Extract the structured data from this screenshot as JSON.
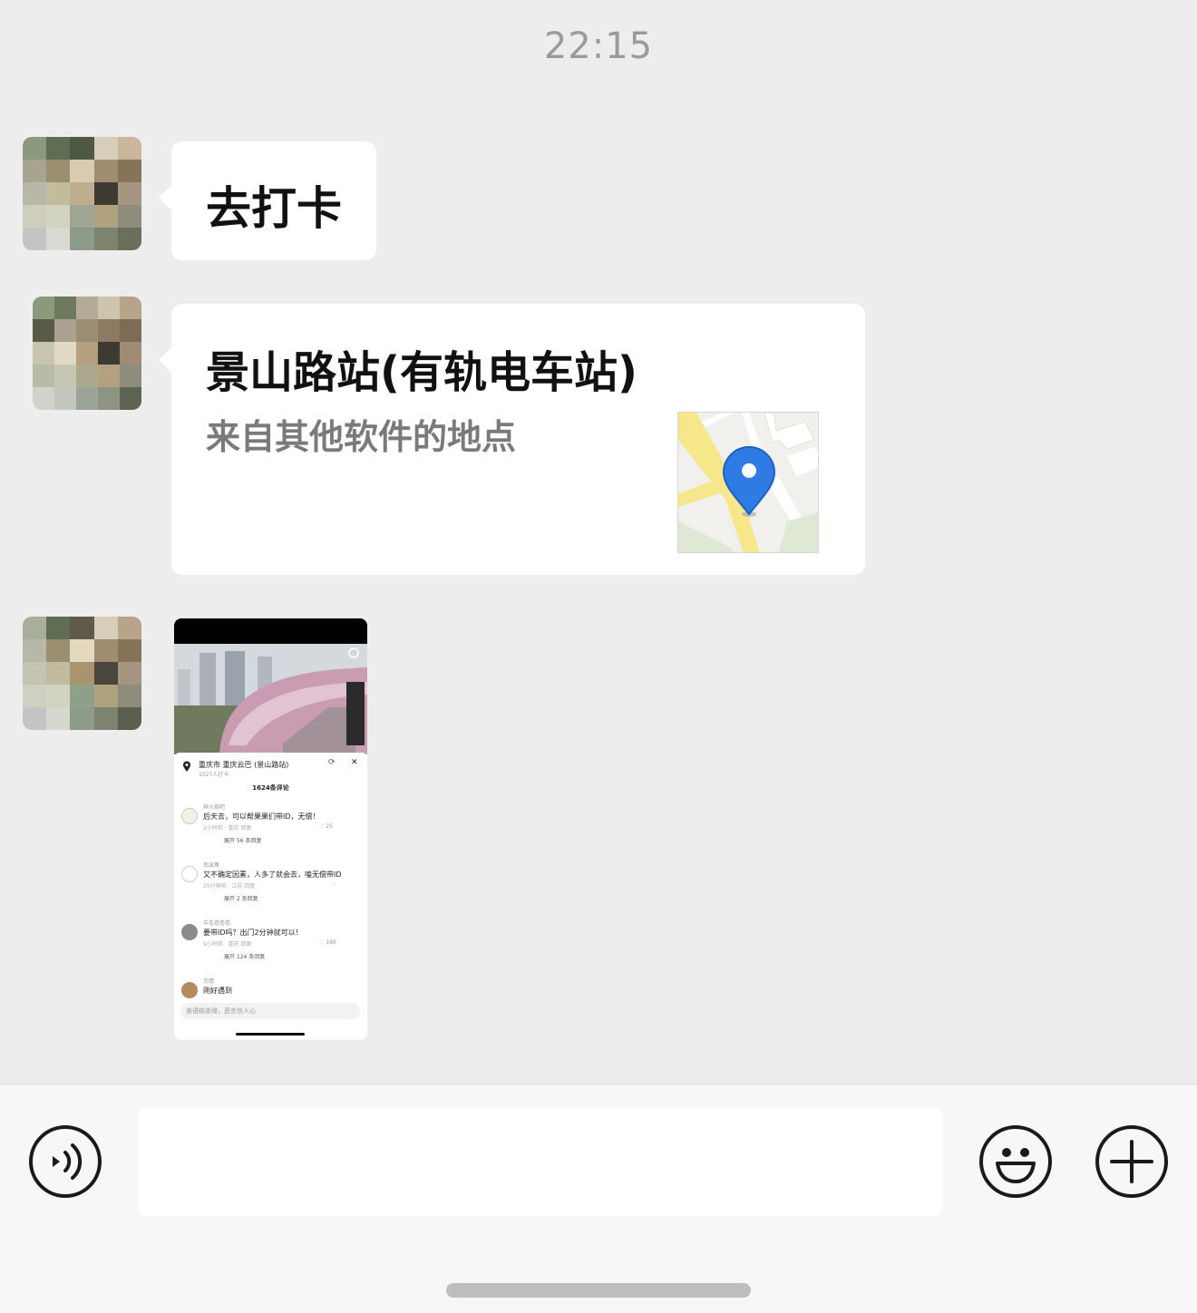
{
  "chat": {
    "timestamp": "22:15",
    "messages": [
      {
        "type": "text",
        "text": "去打卡"
      },
      {
        "type": "location",
        "title": "景山路站(有轨电车站)",
        "subtitle": "来自其他软件的地点",
        "map_icon": "location-pin-icon"
      },
      {
        "type": "image",
        "content": {
          "location_line": "重庆市  重庆云巴 (景山路站)",
          "checkins": "1027人打卡",
          "comments_header": "1624条评论",
          "comments": [
            {
              "name": "神火焰吧",
              "text": "后天去，可以帮果果们带ID，无偿！",
              "meta": "2小时前 · 重庆    回复",
              "likes": "25",
              "replies": "展开 56 条回复"
            },
            {
              "name": "南波萬",
              "text": "又不确定因素，人多了就会去，嗑无偿带ID",
              "meta": "25分钟前 · 江苏    回复",
              "likes": "",
              "replies": "展开 2 条回复"
            },
            {
              "name": "羊毛卷卷卷",
              "text": "要带ID吗？出门2分钟就可以！",
              "meta": "9小时前 · 重庆    回复",
              "likes": "166",
              "replies": "展开 124 条回复"
            },
            {
              "name": "沈倩",
              "text": "刚好遇到",
              "meta": "",
              "likes": "",
              "replies": ""
            }
          ],
          "input_placeholder": "善语结善缘，恶言伤人心"
        }
      }
    ]
  },
  "input_bar": {
    "voice_icon": "voice-icon",
    "emoji_icon": "emoji-icon",
    "plus_icon": "plus-icon",
    "text_value": ""
  },
  "colors": {
    "background": "#ededed",
    "bubble": "#ffffff",
    "map_pin": "#2f7be5"
  }
}
